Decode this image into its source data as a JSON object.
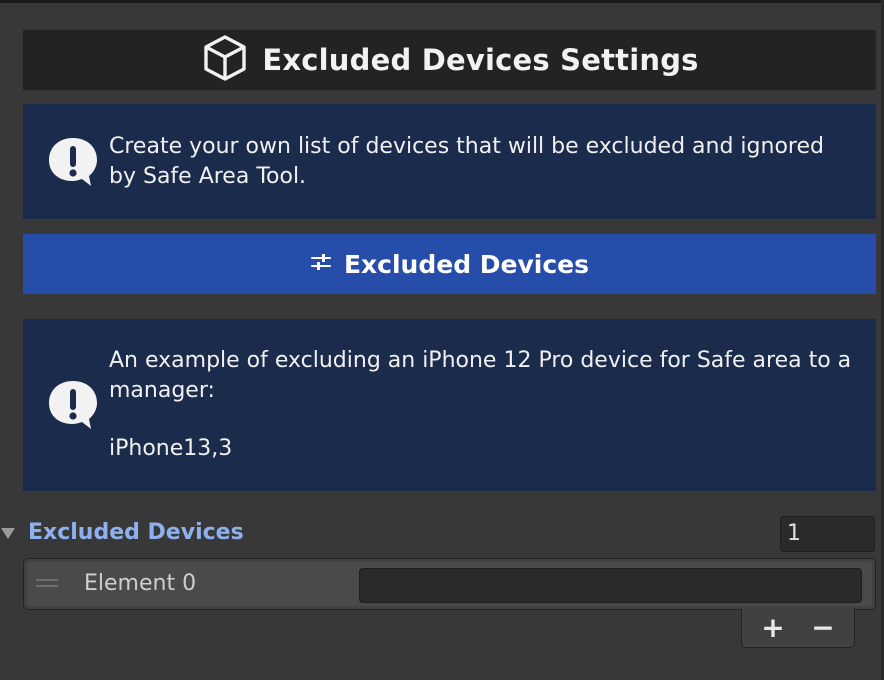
{
  "header": {
    "title": "Excluded Devices Settings",
    "icon": "cube-icon"
  },
  "info_top": {
    "icon": "exclamation-bubble-icon",
    "text": "Create your own list of devices that will be excluded and ignored by Safe Area Tool."
  },
  "excluded_devices_button": {
    "icon": "sliders-icon",
    "label": "Excluded Devices"
  },
  "info_example": {
    "icon": "exclamation-bubble-icon",
    "line1": "An example of excluding an iPhone 12 Pro device for Safe area to a manager:",
    "line2": "iPhone13,3"
  },
  "device_list": {
    "title": "Excluded Devices",
    "size": "1",
    "elements": [
      {
        "label": "Element 0",
        "value": ""
      }
    ],
    "add_label": "+",
    "remove_label": "−"
  },
  "colors": {
    "background": "#383838",
    "header_bg": "#232323",
    "info_bg": "#1a2b4c",
    "button_bg": "#274daa",
    "list_title": "#8fb0ef"
  }
}
